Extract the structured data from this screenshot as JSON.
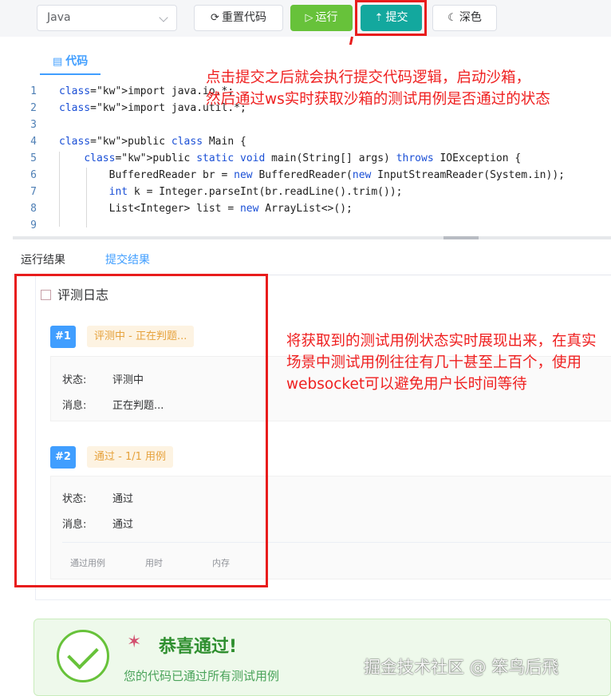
{
  "toolbar": {
    "language": "Java",
    "reset_label": "重置代码",
    "run_label": "运行",
    "submit_label": "提交",
    "dark_label": "深色"
  },
  "editor": {
    "tab_label": "代码",
    "lines": [
      {
        "n": "1",
        "text": "import java.io.*;"
      },
      {
        "n": "2",
        "text": "import java.util.*;"
      },
      {
        "n": "3",
        "text": ""
      },
      {
        "n": "4",
        "text": "public class Main {"
      },
      {
        "n": "5",
        "text": "    public static void main(String[] args) throws IOException {"
      },
      {
        "n": "6",
        "text": "        BufferedReader br = new BufferedReader(new InputStreamReader(System.in));"
      },
      {
        "n": "7",
        "text": "        int k = Integer.parseInt(br.readLine().trim());"
      },
      {
        "n": "8",
        "text": "        List<Integer> list = new ArrayList<>();"
      },
      {
        "n": "9",
        "text": ""
      }
    ]
  },
  "annotations": {
    "top_line1": "点击提交之后就会执行提交代码逻辑，启动沙箱，",
    "top_line2": "然后通过ws实时获取沙箱的测试用例是否通过的状态",
    "mid_text": "将获取到的测试用例状态实时展现出来，在真实场景中测试用例往往有几十甚至上百个，使用websocket可以避免用户长时间等待"
  },
  "result_tabs": {
    "run": "运行结果",
    "submit": "提交结果"
  },
  "judge_log": {
    "title": "评测日志",
    "cases": [
      {
        "index": "#1",
        "tag": "评测中 - 正在判题...",
        "status_key": "状态:",
        "status_value": "评测中",
        "message_key": "消息:",
        "message_value": "正在判题..."
      },
      {
        "index": "#2",
        "tag": "通过 - 1/1 用例",
        "status_key": "状态:",
        "status_value": "通过",
        "message_key": "消息:",
        "message_value": "通过"
      }
    ],
    "stats_headers": [
      "通过用例",
      "用时",
      "内存"
    ]
  },
  "success": {
    "title": "恭喜通过!",
    "subtitle": "您的代码已通过所有测试用例"
  },
  "watermark": "掘金技术社区 @ 笨鸟后飛",
  "colors": {
    "run_green": "#67c23a",
    "submit_teal": "#13a89e",
    "accent_blue": "#409eff",
    "annotation_red": "#ef2020"
  }
}
